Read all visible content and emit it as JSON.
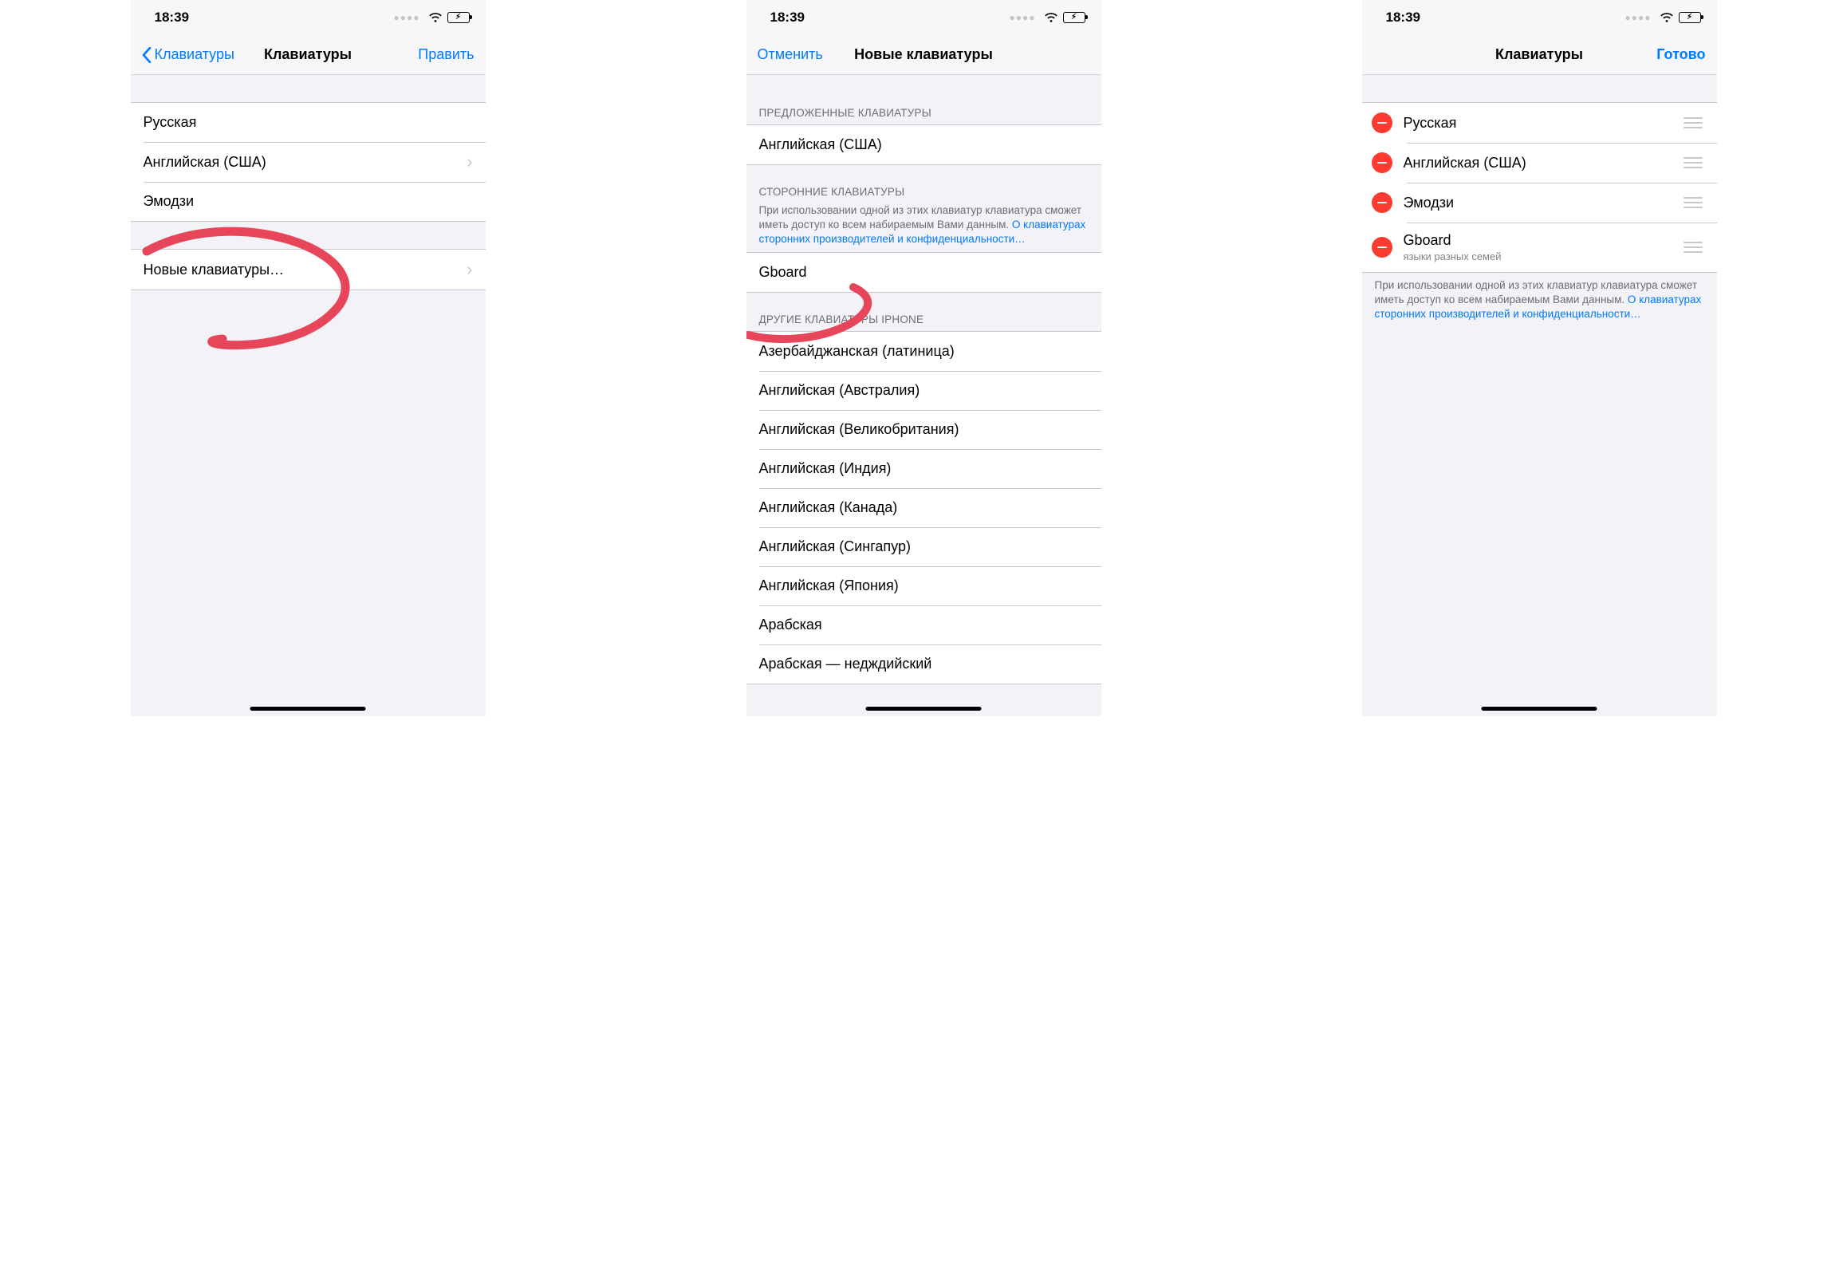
{
  "status": {
    "time": "18:39"
  },
  "colors": {
    "link": "#007aff",
    "destructive": "#ff3b30",
    "battery_fill": "#34c759"
  },
  "screen1": {
    "back_label": "Клавиатуры",
    "title": "Клавиатуры",
    "edit_label": "Править",
    "rows": [
      {
        "label": "Русская"
      },
      {
        "label": "Английская (США)"
      },
      {
        "label": "Эмодзи"
      }
    ],
    "add_row_label": "Новые клавиатуры…"
  },
  "screen2": {
    "cancel_label": "Отменить",
    "title": "Новые клавиатуры",
    "suggested_header": "ПРЕДЛОЖЕННЫЕ КЛАВИАТУРЫ",
    "suggested_rows": [
      {
        "label": "Английская (США)"
      }
    ],
    "third_party_header": "СТОРОННИЕ КЛАВИАТУРЫ",
    "third_party_footer_text": "При использовании одной из этих клавиатур клавиатура сможет иметь доступ ко всем набираемым Вами данным. ",
    "third_party_footer_link": "О клавиатурах сторонних производителей и конфиденциальности…",
    "third_party_rows": [
      {
        "label": "Gboard"
      }
    ],
    "other_header": "ДРУГИЕ КЛАВИАТУРЫ IPHONE",
    "other_rows": [
      {
        "label": "Азербайджанская (латиница)"
      },
      {
        "label": "Английская (Австралия)"
      },
      {
        "label": "Английская (Великобритания)"
      },
      {
        "label": "Английская (Индия)"
      },
      {
        "label": "Английская (Канада)"
      },
      {
        "label": "Английская (Сингапур)"
      },
      {
        "label": "Английская (Япония)"
      },
      {
        "label": "Арабская"
      },
      {
        "label": "Арабская — недждийский"
      }
    ]
  },
  "screen3": {
    "title": "Клавиатуры",
    "done_label": "Готово",
    "rows": [
      {
        "label": "Русская"
      },
      {
        "label": "Английская (США)"
      },
      {
        "label": "Эмодзи"
      },
      {
        "label": "Gboard",
        "sub": "языки разных семей"
      }
    ],
    "footer_text": "При использовании одной из этих клавиатур клавиатура сможет иметь доступ ко всем набираемым Вами данным. ",
    "footer_link": "О клавиатурах сторонних производителей и конфиденциальности…"
  }
}
